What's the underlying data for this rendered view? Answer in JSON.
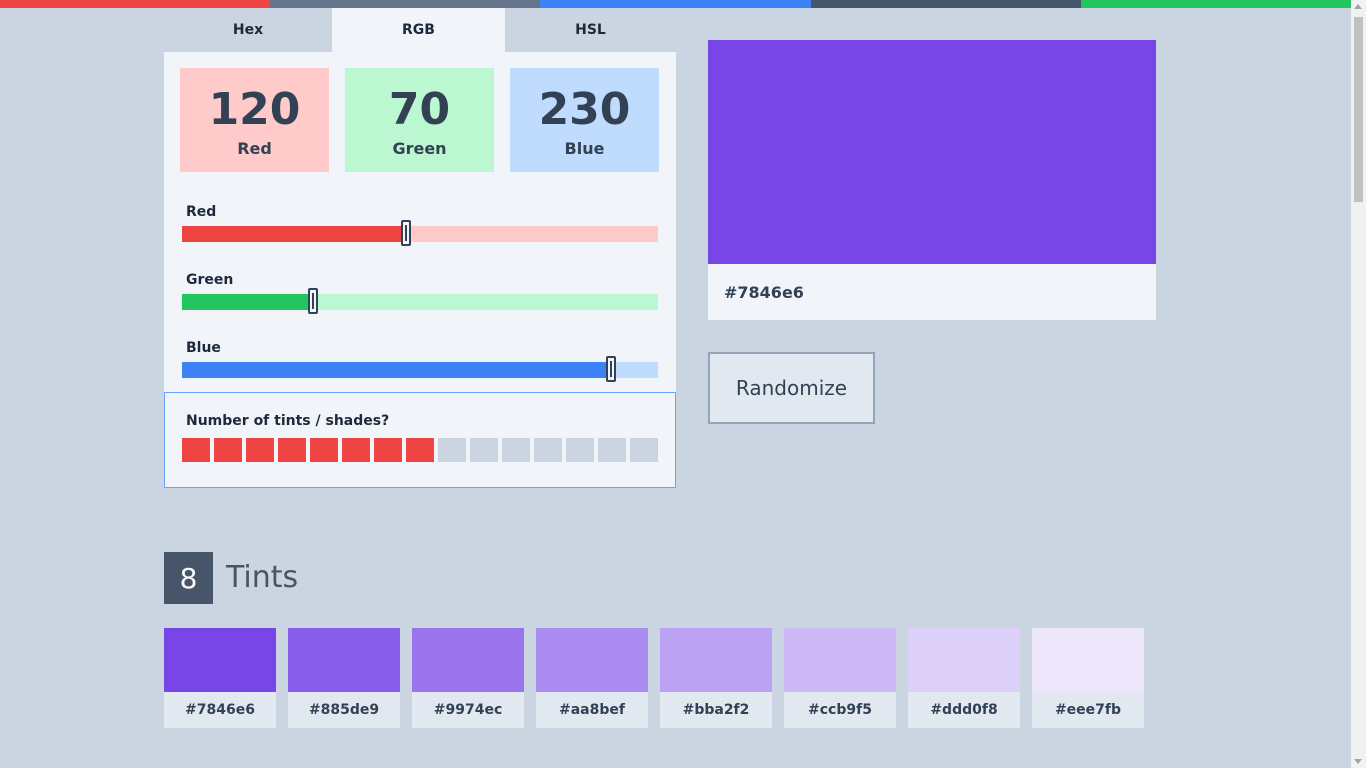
{
  "topbar_colors": [
    "#ef4444",
    "#64748b",
    "#3b82f6",
    "#475569",
    "#22c55e"
  ],
  "tabs": [
    {
      "label": "Hex",
      "active": false
    },
    {
      "label": "RGB",
      "active": true
    },
    {
      "label": "HSL",
      "active": false
    }
  ],
  "rgb": {
    "red": {
      "value": "120",
      "label": "Red",
      "fraction": 0.4706,
      "fill": "#ef4444",
      "track": "#fecaca",
      "box": "#fecaca"
    },
    "green": {
      "value": "70",
      "label": "Green",
      "fraction": 0.2745,
      "fill": "#22c55e",
      "track": "#bbf7d0",
      "box": "#bbf7d0"
    },
    "blue": {
      "value": "230",
      "label": "Blue",
      "fraction": 0.902,
      "fill": "#3b82f6",
      "track": "#bfdbfe",
      "box": "#bfdbfe"
    }
  },
  "sliders": {
    "red_label": "Red",
    "green_label": "Green",
    "blue_label": "Blue"
  },
  "tint_count": {
    "question": "Number of tints / shades?",
    "selected": 8,
    "max": 15
  },
  "preview": {
    "color": "#7846e6",
    "hex": "#7846e6"
  },
  "randomize_label": "Randomize",
  "tints_section": {
    "count": "8",
    "title": "Tints",
    "swatches": [
      {
        "color": "#7846e6",
        "hex": "#7846e6"
      },
      {
        "color": "#885de9",
        "hex": "#885de9"
      },
      {
        "color": "#9974ec",
        "hex": "#9974ec"
      },
      {
        "color": "#aa8bef",
        "hex": "#aa8bef"
      },
      {
        "color": "#bba2f2",
        "hex": "#bba2f2"
      },
      {
        "color": "#ccb9f5",
        "hex": "#ccb9f5"
      },
      {
        "color": "#ddd0f8",
        "hex": "#ddd0f8"
      },
      {
        "color": "#eee7fb",
        "hex": "#eee7fb"
      }
    ]
  }
}
